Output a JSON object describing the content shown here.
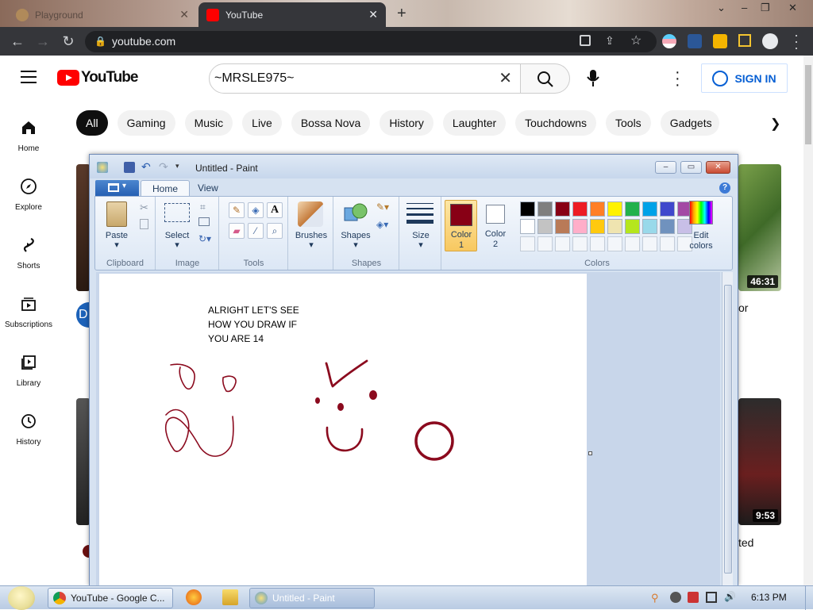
{
  "browser": {
    "tabs": [
      {
        "title": "Playground",
        "active": false
      },
      {
        "title": "YouTube",
        "active": true
      }
    ],
    "url": "youtube.com",
    "new_tab_symbol": "+",
    "window_controls": [
      "⌄",
      "–",
      "❐",
      "✕"
    ]
  },
  "youtube": {
    "logo_text": "YouTube",
    "search_value": "~MRSLE975~",
    "sign_in_label": "SIGN IN",
    "chips": [
      "All",
      "Gaming",
      "Music",
      "Live",
      "Bossa Nova",
      "History",
      "Laughter",
      "Touchdowns",
      "Tools",
      "Gadgets"
    ],
    "nav": [
      {
        "label": "Home",
        "icon": "home-icon"
      },
      {
        "label": "Explore",
        "icon": "compass-icon"
      },
      {
        "label": "Shorts",
        "icon": "shorts-icon"
      },
      {
        "label": "Subscriptions",
        "icon": "subscriptions-icon"
      },
      {
        "label": "Library",
        "icon": "library-icon"
      },
      {
        "label": "History",
        "icon": "history-icon"
      }
    ],
    "thumbnails": [
      {
        "duration": "46:31",
        "title_fragment": "or"
      },
      {
        "duration": "9:53",
        "title_fragment": "ted"
      }
    ],
    "avatar_letter": "D"
  },
  "paint": {
    "title": "Untitled - Paint",
    "ribbon_tabs": [
      "Home",
      "View"
    ],
    "groups": {
      "clipboard": {
        "label": "Clipboard",
        "paste": "Paste"
      },
      "image": {
        "label": "Image",
        "select": "Select"
      },
      "tools": {
        "label": "Tools"
      },
      "brushes": {
        "label": "Brushes"
      },
      "shapes": {
        "label": "Shapes",
        "shapes_btn": "Shapes"
      },
      "size": {
        "label": "Size"
      },
      "color1": {
        "line1": "Color",
        "line2": "1"
      },
      "color2": {
        "line1": "Color",
        "line2": "2"
      },
      "colors": {
        "label": "Colors"
      },
      "edit_colors": {
        "line1": "Edit",
        "line2": "colors"
      }
    },
    "palette_row1": [
      "#000000",
      "#7f7f7f",
      "#880015",
      "#ed1c24",
      "#ff7f27",
      "#fff200",
      "#22b14c",
      "#00a2e8",
      "#3f48cc",
      "#a349a4"
    ],
    "palette_row2": [
      "#ffffff",
      "#c3c3c3",
      "#b97a57",
      "#ffaec9",
      "#ffc90e",
      "#efe4b0",
      "#b5e61d",
      "#99d9ea",
      "#7092be",
      "#c8bfe7"
    ],
    "color1_value": "#880015",
    "color2_value": "#ffffff",
    "canvas_text": "ALRIGHT LET'S SEE\nHOW YOU DRAW IF\nYOU ARE 14",
    "ink_color": "#8b0a1e"
  },
  "taskbar": {
    "items": [
      {
        "label": "YouTube - Google C...",
        "active": false
      },
      {
        "label": "Untitled - Paint",
        "active": true
      }
    ],
    "clock": "6:13 PM"
  }
}
